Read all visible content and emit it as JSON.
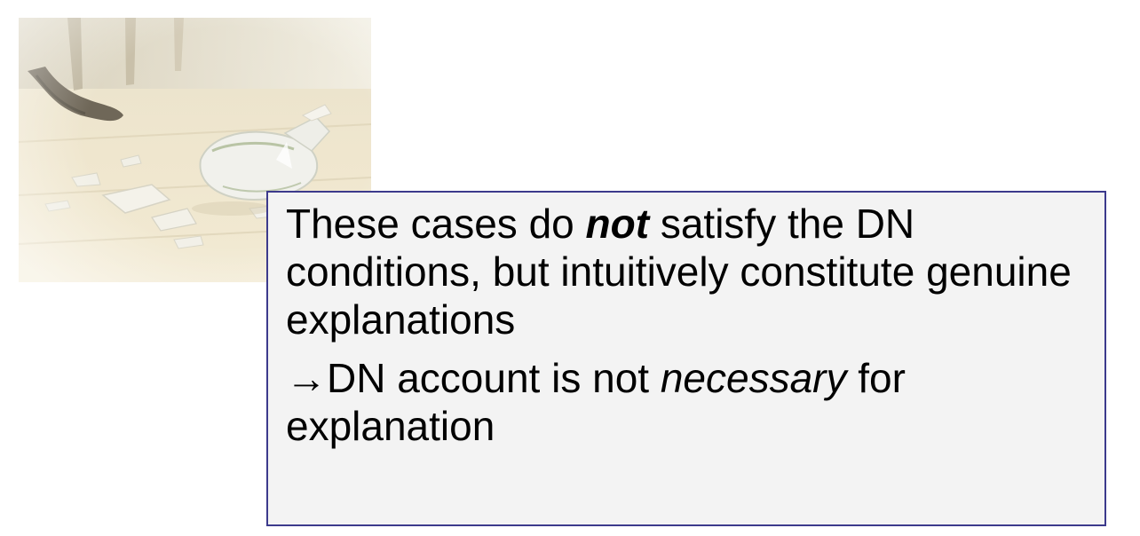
{
  "image": {
    "icon": "broken-vase-photo"
  },
  "paragraph_1": {
    "before": "These cases do ",
    "emphasis": "not",
    "after": " satisfy the DN conditions, but intuitively constitute genuine explanations"
  },
  "paragraph_2": {
    "arrow": "→",
    "before": "DN account is not ",
    "emphasis": "necessary",
    "after": " for explanation"
  },
  "colors": {
    "box_border": "#3c3a8c",
    "box_fill": "#f3f3f3",
    "text": "#000000"
  }
}
